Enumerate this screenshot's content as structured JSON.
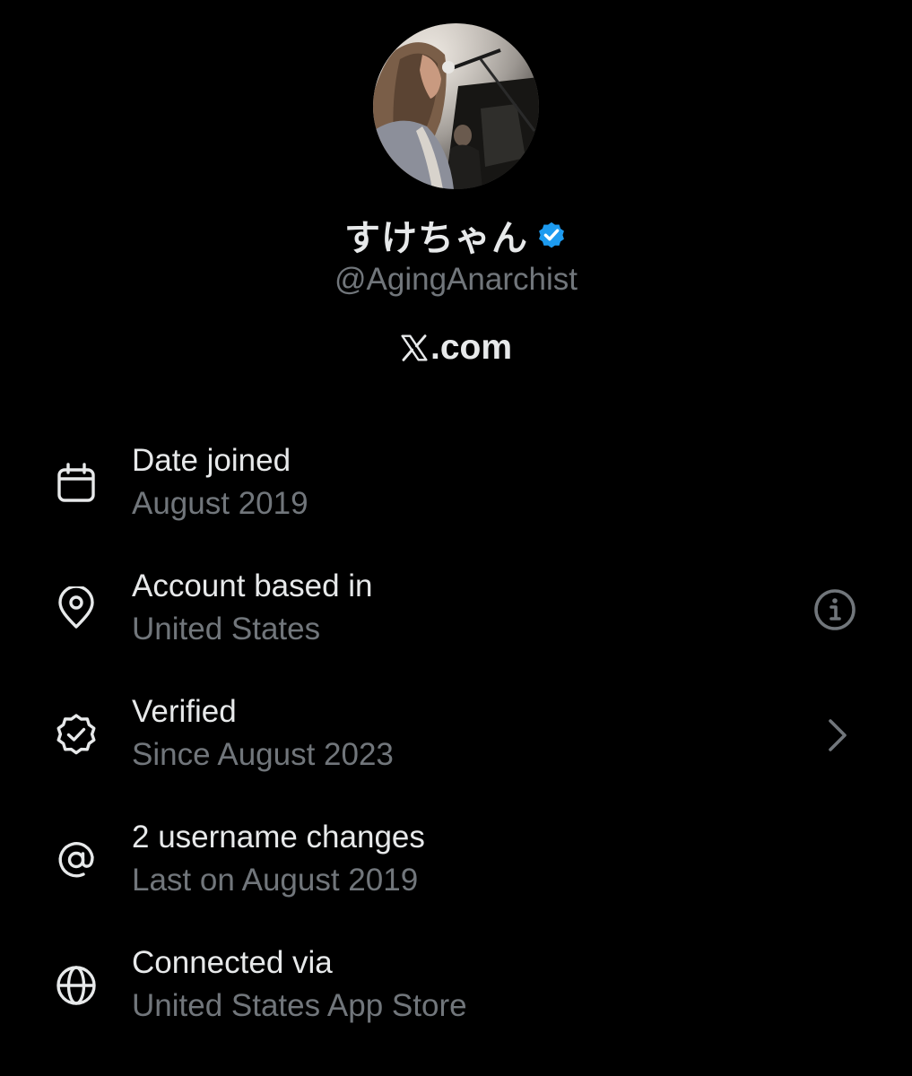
{
  "profile": {
    "display_name": "すけちゃん",
    "handle": "@AgingAnarchist",
    "site_domain": ".com",
    "site_logo_letter": "X",
    "verified_badge_color": "#1d9bf0"
  },
  "rows": [
    {
      "icon": "calendar-icon",
      "title": "Date joined",
      "subtitle": "August 2019",
      "action": null
    },
    {
      "icon": "location-pin-icon",
      "title": "Account based in",
      "subtitle": "United States",
      "action": "info-icon"
    },
    {
      "icon": "verified-badge-icon",
      "title": "Verified",
      "subtitle": "Since August 2023",
      "action": "chevron-right-icon"
    },
    {
      "icon": "at-sign-icon",
      "title": "2 username changes",
      "subtitle": "Last on August 2019",
      "action": null
    },
    {
      "icon": "globe-icon",
      "title": "Connected via",
      "subtitle": "United States App Store",
      "action": null
    }
  ],
  "colors": {
    "background": "#000000",
    "primary_text": "#e7e9ea",
    "secondary_text": "#71767b",
    "accent": "#1d9bf0"
  }
}
